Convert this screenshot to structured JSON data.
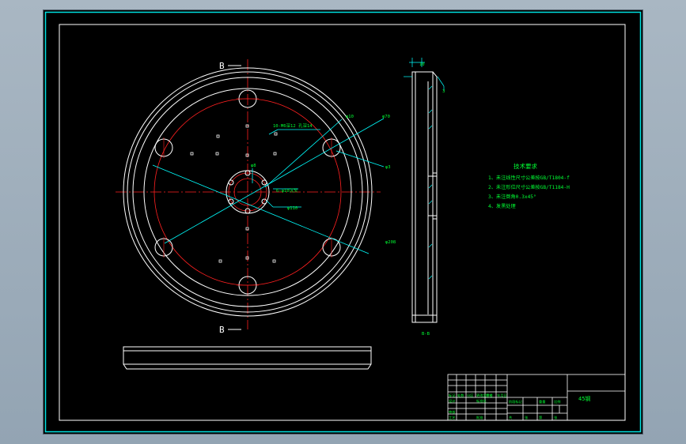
{
  "section_markers": {
    "top": "B",
    "bottom": "B"
  },
  "dimensions": {
    "d1": "10-M6深12 孔深14",
    "d2": "φ10",
    "d3": "φ70",
    "d4": "φ8",
    "d5": "φ3",
    "d6": "6-φ10沉头",
    "d7": "φ110",
    "d8": "φ208",
    "side_top": "10",
    "side_right": "3"
  },
  "section_view_label": "B-B",
  "technical_requirements": {
    "title": "技术要求",
    "items": [
      "1、未注线性尺寸公差按GB/T1804-f",
      "2、未注形位尺寸公差按GB/T1184-H",
      "3、未注倒角0.3x45°",
      "4、发黑处理"
    ]
  },
  "title_block": {
    "material": "45钢",
    "cells_row1": [
      "标记",
      "处数",
      "分区",
      "更改文件号",
      "签名",
      "年月日"
    ],
    "cells_row2": [
      "设计",
      "",
      "",
      "标准化",
      "",
      ""
    ],
    "cells_row3": [
      "阶段标记",
      "重量",
      "比例"
    ],
    "cells_row4": [
      "审核",
      "",
      "",
      "",
      "",
      ""
    ],
    "cells_row5": [
      "工艺",
      "",
      "",
      "批准",
      "",
      ""
    ],
    "sheet": [
      "共",
      "张",
      "第",
      "张"
    ]
  },
  "colors": {
    "outline": "#ffffff",
    "center_line": "#ff2020",
    "dimension": "#00ffff",
    "text": "#00ff33",
    "frame": "#ffffff",
    "viewport_border": "#00e0e0"
  }
}
